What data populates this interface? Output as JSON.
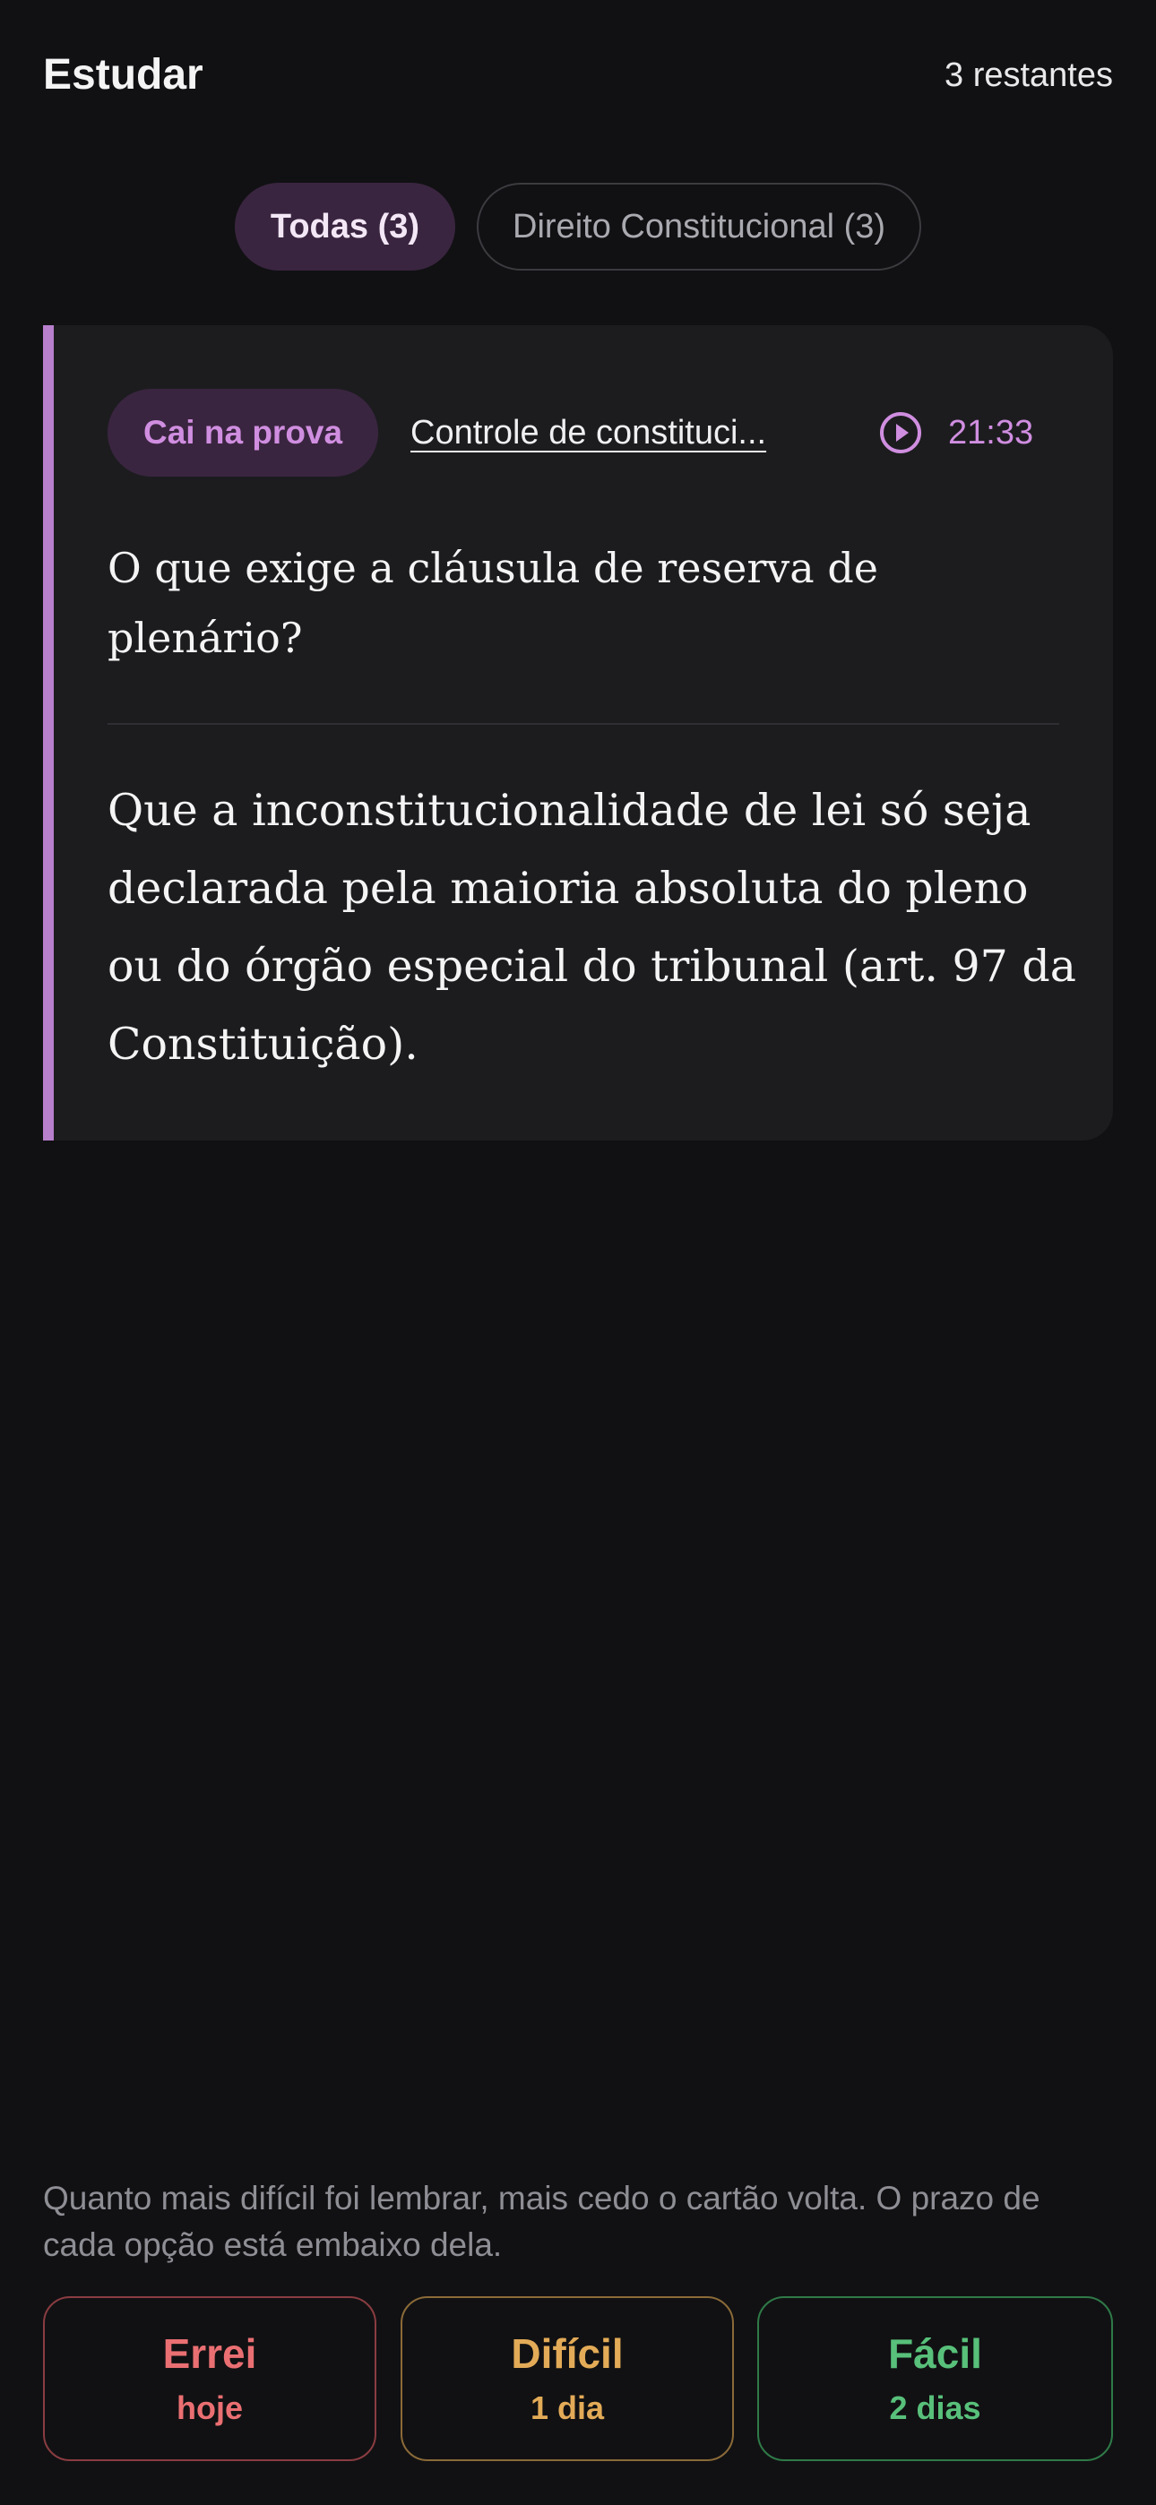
{
  "header": {
    "title": "Estudar",
    "remaining": "3 restantes"
  },
  "filters": [
    {
      "label": "Todas (3)",
      "active": true
    },
    {
      "label": "Direito Constitucional (3)",
      "active": false
    }
  ],
  "card": {
    "tag": "Cai na prova",
    "topic_link": "Controle de constituci...",
    "timestamp": "21:33",
    "timestamp_icon": "play-circle-icon",
    "question": "O que exige a cláusula de reserva de plenário?",
    "answer": "Que a inconstitucionalidade de lei só seja declarada pela maioria absoluta do pleno ou do órgão especial do tribunal (art. 97 da Constituição)."
  },
  "hint": "Quanto mais difícil foi lembrar, mais cedo o cartão volta. O prazo de cada opção está embaixo dela.",
  "actions": {
    "wrong": {
      "label": "Errei",
      "interval": "hoje"
    },
    "hard": {
      "label": "Difícil",
      "interval": "1 dia"
    },
    "easy": {
      "label": "Fácil",
      "interval": "2 dias"
    }
  },
  "colors": {
    "background": "#111113",
    "card": "#1c1c1f",
    "accent": "#b87fcc",
    "accent_text": "#d08ee0",
    "wrong": "#ea6f72",
    "hard": "#e3ab57",
    "easy": "#58c07a"
  }
}
